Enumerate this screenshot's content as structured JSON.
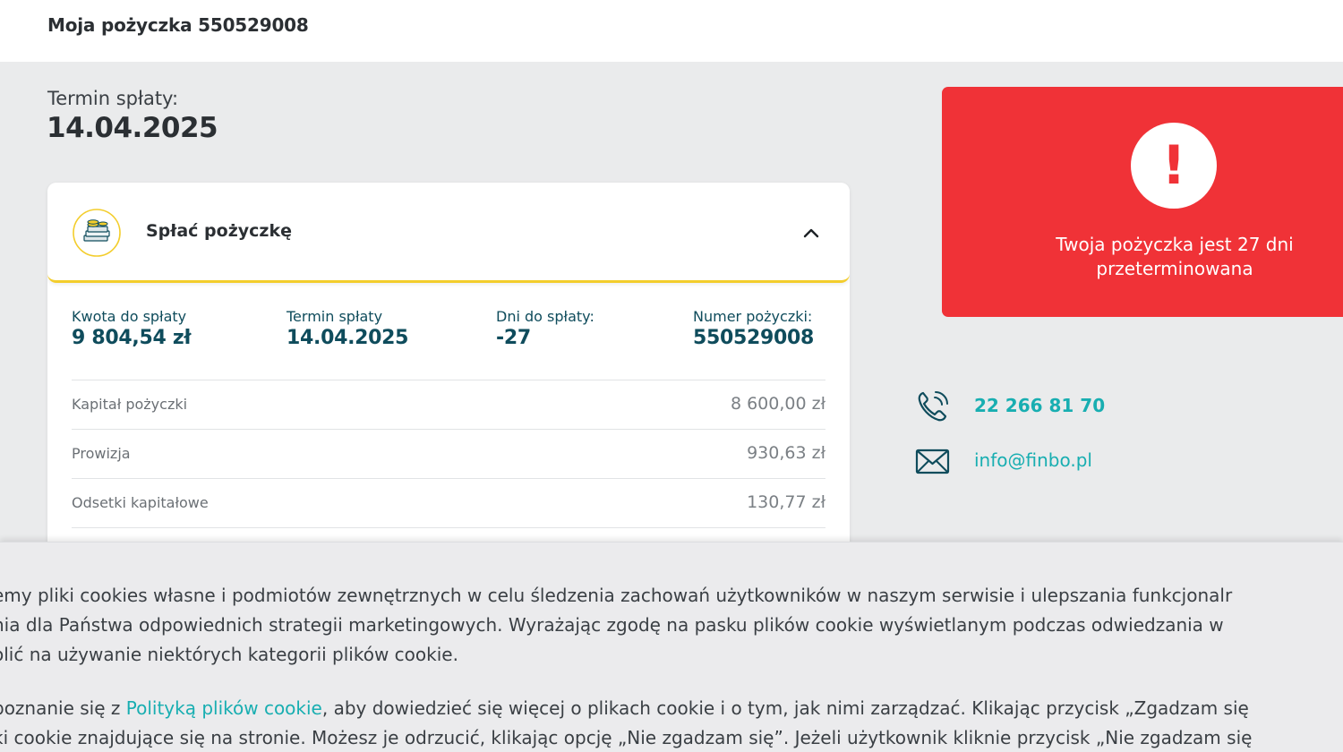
{
  "header": {
    "title": "Moja pożyczka 550529008"
  },
  "due": {
    "label": "Termin spłaty:",
    "date": "14.04.2025"
  },
  "card": {
    "title": "Spłać pożyczkę",
    "stats": [
      {
        "label": "Kwota do spłaty",
        "value": "9 804,54 zł"
      },
      {
        "label": "Termin spłaty",
        "value": "14.04.2025"
      },
      {
        "label": "Dni do spłaty:",
        "value": "-27"
      },
      {
        "label": "Numer pożyczki:",
        "value": "550529008"
      }
    ],
    "rows": [
      {
        "label": "Kapitał pożyczki",
        "value": "8 600,00 zł"
      },
      {
        "label": "Prowizja",
        "value": "930,63 zł"
      },
      {
        "label": "Odsetki kapitałowe",
        "value": "130,77 zł"
      }
    ]
  },
  "alert": {
    "icon": "exclamation-icon",
    "mark": "!",
    "message": "Twoja pożyczka jest 27 dni przeterminowana"
  },
  "contact": {
    "phone": "22 266 81 70",
    "email": "info@finbo.pl"
  },
  "cookie": {
    "line1": "emy pliki cookies własne i podmiotów zewnętrznych w celu śledzenia zachowań użytkowników w naszym serwisie i ulepszania funkcjonalr",
    "line2": "nia dla Państwa odpowiednich strategii marketingowych. Wyrażając zgodę na pasku plików cookie wyświetlanym podczas odwiedzania w",
    "line3": "olić na używanie niektórych kategorii plików cookie.",
    "line4_pre": "poznanie się z ",
    "line4_link": "Polityką plików cookie",
    "line4_post": ", aby dowiedzieć się więcej o plikach cookie i o tym, jak nimi zarządzać. Klikając przycisk „Zgadzam się",
    "line5": "ki cookie znajdujące się na stronie. Możesz je odrzucić, klikając opcję „Nie zgadzam się”. Jeżeli użytkownik kliknie przycisk „Nie zgadzam się"
  },
  "colors": {
    "accent": "#18aeb1",
    "alert": "#f03237",
    "navy": "#0f4c5c",
    "highlight": "#f3cd2c"
  }
}
